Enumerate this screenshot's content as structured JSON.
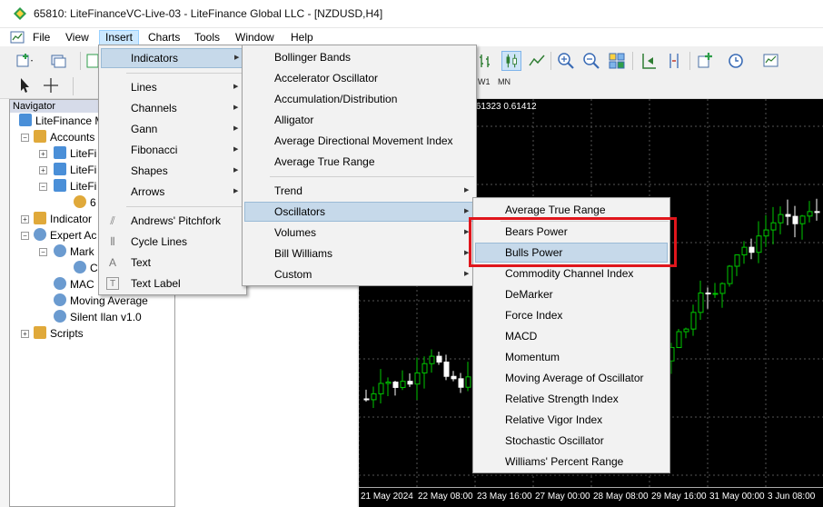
{
  "window": {
    "title": "65810: LiteFinanceVC-Live-03 - LiteFinance Global LLC - [NZDUSD,H4]"
  },
  "menubar": {
    "items": [
      "File",
      "View",
      "Insert",
      "Charts",
      "Tools",
      "Window",
      "Help"
    ],
    "open": "Insert"
  },
  "timeframes": [
    "W1",
    "MN"
  ],
  "navigator": {
    "title": "Navigator",
    "items": [
      {
        "label": "LiteFinance M",
        "icon": "terminal-icon"
      },
      {
        "label": "Accounts",
        "icon": "accounts-icon"
      },
      {
        "label": "LiteFi",
        "icon": "account-icon"
      },
      {
        "label": "LiteFi",
        "icon": "account-icon"
      },
      {
        "label": "LiteFi",
        "icon": "account-icon"
      },
      {
        "label": "6",
        "icon": "user-icon"
      },
      {
        "label": "Indicator",
        "icon": "indicator-icon"
      },
      {
        "label": "Expert Ac",
        "icon": "expert-icon"
      },
      {
        "label": "Mark",
        "icon": "expert-icon"
      },
      {
        "label": "C",
        "icon": "expert-icon"
      },
      {
        "label": "MAC",
        "icon": "expert-icon"
      },
      {
        "label": "Moving Average",
        "icon": "expert-icon"
      },
      {
        "label": "Silent Ilan v1.0",
        "icon": "expert-icon"
      },
      {
        "label": "Scripts",
        "icon": "scripts-icon"
      }
    ]
  },
  "insert_menu": {
    "items": [
      {
        "label": "Indicators",
        "submenu": true,
        "highlighted": true
      },
      {
        "label": "Lines",
        "submenu": true
      },
      {
        "label": "Channels",
        "submenu": true
      },
      {
        "label": "Gann",
        "submenu": true
      },
      {
        "label": "Fibonacci",
        "submenu": true
      },
      {
        "label": "Shapes",
        "submenu": true
      },
      {
        "label": "Arrows",
        "submenu": true
      },
      {
        "label": "Andrews' Pitchfork",
        "icon": "pitchfork-icon"
      },
      {
        "label": "Cycle Lines",
        "icon": "cycle-lines-icon"
      },
      {
        "label": "Text",
        "icon": "text-icon"
      },
      {
        "label": "Text Label",
        "icon": "text-label-icon"
      }
    ]
  },
  "indicators_menu": {
    "items": [
      {
        "label": "Bollinger Bands"
      },
      {
        "label": "Accelerator Oscillator"
      },
      {
        "label": "Accumulation/Distribution"
      },
      {
        "label": "Alligator"
      },
      {
        "label": "Average Directional Movement Index"
      },
      {
        "label": "Average True Range"
      },
      {
        "label": "Trend",
        "submenu": true
      },
      {
        "label": "Oscillators",
        "submenu": true,
        "highlighted": true
      },
      {
        "label": "Volumes",
        "submenu": true
      },
      {
        "label": "Bill Williams",
        "submenu": true
      },
      {
        "label": "Custom",
        "submenu": true
      }
    ]
  },
  "oscillators_menu": {
    "items": [
      {
        "label": "Average True Range"
      },
      {
        "label": "Bears Power"
      },
      {
        "label": "Bulls Power",
        "highlighted": true
      },
      {
        "label": "Commodity Channel Index"
      },
      {
        "label": "DeMarker"
      },
      {
        "label": "Force Index"
      },
      {
        "label": "MACD"
      },
      {
        "label": "Momentum"
      },
      {
        "label": "Moving Average of Oscillator"
      },
      {
        "label": "Relative Strength Index"
      },
      {
        "label": "Relative Vigor Index"
      },
      {
        "label": "Stochastic Oscillator"
      },
      {
        "label": "Williams' Percent Range"
      }
    ]
  },
  "chart": {
    "symbol_info": "430 0.61323 0.61412",
    "dates": [
      "21 May 2024",
      "22 May 08:00",
      "23 May 16:00",
      "27 May 00:00",
      "28 May 08:00",
      "29 May 16:00",
      "31 May 00:00",
      "3 Jun 08:00"
    ],
    "bull_color": "#00c800",
    "bear_color": "#ffffff"
  },
  "colors": {
    "highlight": "#c6d9ea",
    "callout": "#e0161c"
  }
}
